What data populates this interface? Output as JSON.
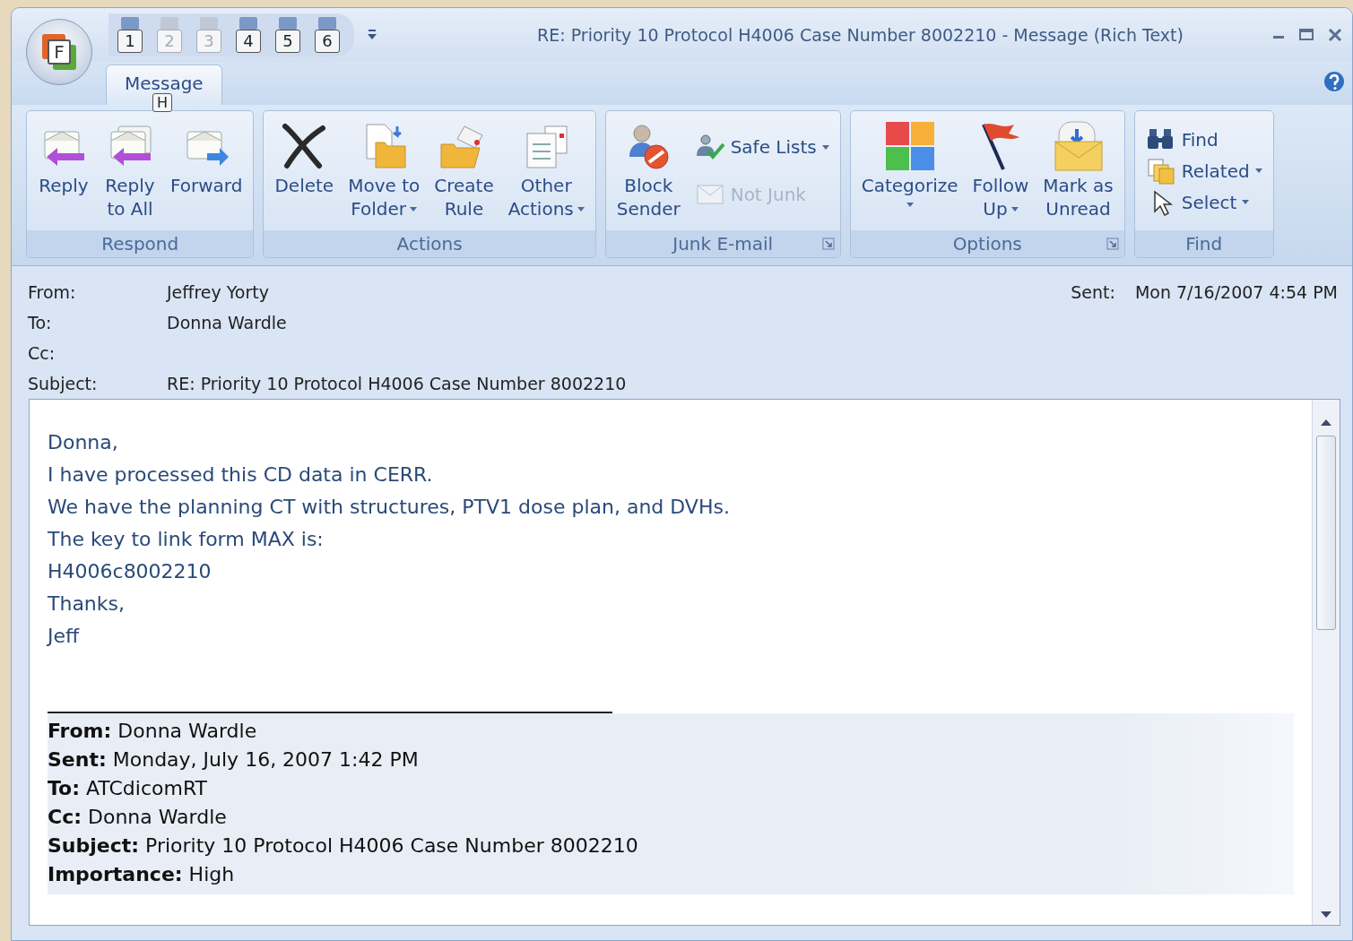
{
  "window": {
    "title": "RE: Priority 10 Protocol  H4006 Case Number 8002210  -  Message (Rich Text)",
    "app_key": "F"
  },
  "quick_access": [
    {
      "key": "1",
      "disabled": false
    },
    {
      "key": "2",
      "disabled": true
    },
    {
      "key": "3",
      "disabled": true
    },
    {
      "key": "4",
      "disabled": false
    },
    {
      "key": "5",
      "disabled": false
    },
    {
      "key": "6",
      "disabled": false
    }
  ],
  "tabs": [
    {
      "label": "Message",
      "selected": true,
      "key_tip": "H"
    }
  ],
  "ribbon": {
    "groups": [
      {
        "label": "Respond",
        "launcher": false,
        "buttons": [
          {
            "kind": "large",
            "lines": [
              "Reply"
            ],
            "dropdown": false,
            "disabled": false
          },
          {
            "kind": "large",
            "lines": [
              "Reply",
              "to All"
            ],
            "dropdown": false,
            "disabled": false
          },
          {
            "kind": "large",
            "lines": [
              "Forward"
            ],
            "dropdown": false,
            "disabled": false
          }
        ]
      },
      {
        "label": "Actions",
        "launcher": false,
        "buttons": [
          {
            "kind": "large",
            "lines": [
              "Delete"
            ],
            "dropdown": false,
            "disabled": false
          },
          {
            "kind": "large",
            "lines": [
              "Move to",
              "Folder"
            ],
            "dropdown": true,
            "disabled": false
          },
          {
            "kind": "large",
            "lines": [
              "Create",
              "Rule"
            ],
            "dropdown": false,
            "disabled": false
          },
          {
            "kind": "large",
            "lines": [
              "Other",
              "Actions"
            ],
            "dropdown": true,
            "disabled": false
          }
        ]
      },
      {
        "label": "Junk E-mail",
        "launcher": true,
        "buttons": [
          {
            "kind": "large",
            "lines": [
              "Block",
              "Sender"
            ],
            "dropdown": false,
            "disabled": false
          },
          {
            "kind": "small",
            "lines": [
              "Safe Lists"
            ],
            "dropdown": true,
            "disabled": false
          },
          {
            "kind": "small",
            "lines": [
              "Not Junk"
            ],
            "dropdown": false,
            "disabled": true
          }
        ]
      },
      {
        "label": "Options",
        "launcher": true,
        "buttons": [
          {
            "kind": "large",
            "lines": [
              "Categorize"
            ],
            "dropdown": true,
            "disabled": false
          },
          {
            "kind": "large",
            "lines": [
              "Follow",
              "Up"
            ],
            "dropdown": true,
            "disabled": false
          },
          {
            "kind": "large",
            "lines": [
              "Mark as",
              "Unread"
            ],
            "dropdown": false,
            "disabled": false
          }
        ]
      },
      {
        "label": "Find",
        "launcher": false,
        "buttons": [
          {
            "kind": "small",
            "lines": [
              "Find"
            ],
            "dropdown": false,
            "disabled": false
          },
          {
            "kind": "small",
            "lines": [
              "Related"
            ],
            "dropdown": true,
            "disabled": false
          },
          {
            "kind": "small",
            "lines": [
              "Select"
            ],
            "dropdown": true,
            "disabled": false
          }
        ]
      }
    ]
  },
  "header": {
    "fields": [
      {
        "label": "From:",
        "value": "Jeffrey Yorty"
      },
      {
        "label": "To:",
        "value": "Donna Wardle"
      },
      {
        "label": "Cc:"
      },
      {
        "label": "Subject:",
        "value": "RE: Priority 10 Protocol  H4006 Case Number 8002210"
      }
    ],
    "sent": {
      "label": "Sent:",
      "value": "Mon 7/16/2007 4:54 PM"
    }
  },
  "body": {
    "lines": [
      "Donna,",
      "I have processed this CD data in CERR.",
      "We have the planning CT with structures, PTV1 dose plan, and DVHs.",
      "The key to link form MAX is:",
      "H4006c8002210",
      "Thanks,",
      "Jeff"
    ],
    "quoted_header": [
      {
        "label": "From:",
        "value": "Donna Wardle"
      },
      {
        "label": "Sent:",
        "value": "Monday, July 16, 2007 1:42 PM"
      },
      {
        "label": "To:",
        "value": "ATCdicomRT"
      },
      {
        "label": "Cc:",
        "value": "Donna Wardle"
      },
      {
        "label": "Subject:",
        "value": "Priority 10 Protocol H4006 Case Number 8002210"
      },
      {
        "label": "Importance:",
        "value": "High"
      }
    ]
  }
}
